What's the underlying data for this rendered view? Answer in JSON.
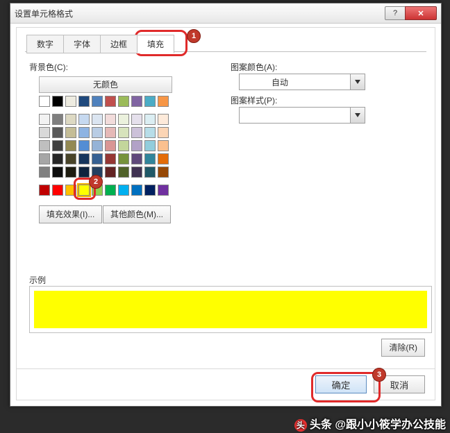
{
  "title": "设置单元格格式",
  "tabs": [
    "数字",
    "字体",
    "边框",
    "填充"
  ],
  "active_tab_index": 3,
  "labels": {
    "bg_color": "背景色(C):",
    "no_color": "无颜色",
    "fill_effects": "填充效果(I)...",
    "other_colors": "其他颜色(M)...",
    "pattern_color": "图案颜色(A):",
    "pattern_style": "图案样式(P):",
    "auto": "自动",
    "sample": "示例",
    "clear": "清除(R)",
    "ok": "确定",
    "cancel": "取消"
  },
  "selected": {
    "bg_color": "#FFFF00"
  },
  "palette": {
    "row0": [
      "#FFFFFF",
      "#000000",
      "#EEECE1",
      "#1F497D",
      "#4F81BD",
      "#C0504D",
      "#9BBB59",
      "#8064A2",
      "#4BACC6",
      "#F79646"
    ],
    "theme": [
      [
        "#F2F2F2",
        "#7F7F7F",
        "#DDD9C3",
        "#C6D9F0",
        "#DBE5F1",
        "#F2DCDB",
        "#EBF1DD",
        "#E5E0EC",
        "#DBEEF3",
        "#FDEADA"
      ],
      [
        "#D9D9D9",
        "#595959",
        "#C4BD97",
        "#8DB3E2",
        "#B8CCE4",
        "#E5B9B7",
        "#D7E3BC",
        "#CCC1D9",
        "#B7DDE8",
        "#FBD5B5"
      ],
      [
        "#BFBFBF",
        "#404040",
        "#938953",
        "#548DD4",
        "#95B3D7",
        "#D99694",
        "#C3D69B",
        "#B2A2C7",
        "#92CDDC",
        "#FAC08F"
      ],
      [
        "#A6A6A6",
        "#262626",
        "#494429",
        "#17365D",
        "#366092",
        "#953734",
        "#76923C",
        "#5F497A",
        "#31859B",
        "#E36C09"
      ],
      [
        "#808080",
        "#0D0D0D",
        "#1D1B10",
        "#0F243E",
        "#244061",
        "#632423",
        "#4F6128",
        "#3F3151",
        "#205867",
        "#974806"
      ]
    ],
    "standard": [
      "#C00000",
      "#FF0000",
      "#FFC000",
      "#FFFF00",
      "#92D050",
      "#00B050",
      "#00B0F0",
      "#0070C0",
      "#002060",
      "#7030A0"
    ]
  },
  "callouts": {
    "1": "1",
    "2": "2",
    "3": "3"
  },
  "watermark": "头条 @跟小小筱学办公技能"
}
